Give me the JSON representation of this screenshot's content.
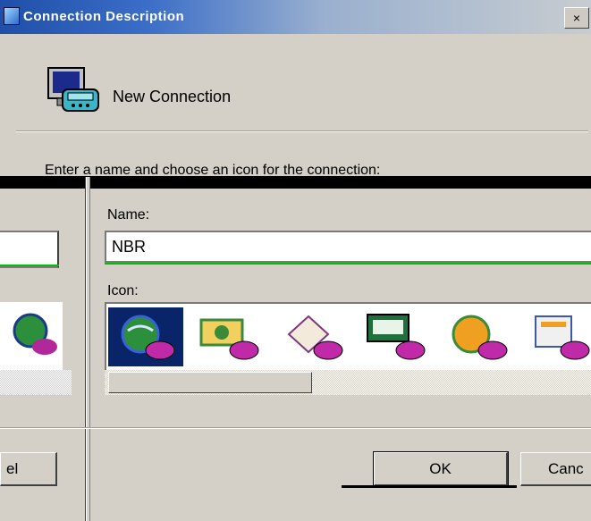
{
  "window": {
    "title": "Connection Description",
    "close_glyph": "×"
  },
  "header": {
    "label": "New Connection",
    "icon": "computer-phone-icon"
  },
  "instruction": "Enter a name and choose an icon for the connection:",
  "name_field": {
    "label": "Name:",
    "value": "NBR"
  },
  "icon_field": {
    "label": "Icon:",
    "icons": [
      "globe-phone-icon",
      "money-phone-icon",
      "envelope-phone-icon",
      "computer-phone-icon",
      "house-phone-icon",
      "document-phone-icon"
    ],
    "selected_index": 0
  },
  "buttons": {
    "ok": "OK",
    "cancel_right": "Canc",
    "cancel_left": "el"
  },
  "colors": {
    "face": "#d4d0c8",
    "selection": "#0a246a",
    "focus_green": "#00c000"
  }
}
